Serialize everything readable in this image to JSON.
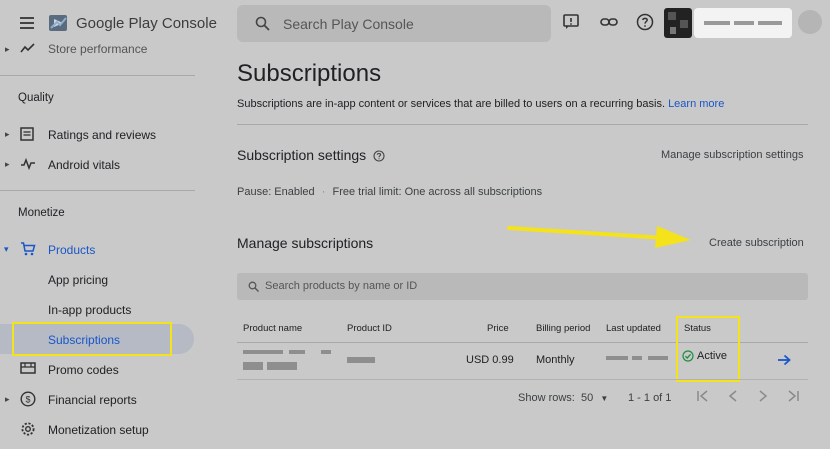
{
  "topbar": {
    "brand": "Google Play Console",
    "search_placeholder": "Search Play Console"
  },
  "sidebar": {
    "partial_item": "Store performance",
    "sections": [
      {
        "heading": "Quality"
      },
      {
        "heading": "Monetize"
      }
    ],
    "quality_items": [
      "Ratings and reviews",
      "Android vitals"
    ],
    "monetize_items": {
      "products": "Products",
      "app_pricing": "App pricing",
      "inapp": "In-app products",
      "subscriptions": "Subscriptions",
      "promo": "Promo codes",
      "financial": "Financial reports",
      "setup": "Monetization setup"
    }
  },
  "main": {
    "title": "Subscriptions",
    "subtitle": "Subscriptions are in-app content or services that are billed to users on a recurring basis.",
    "learn_more": "Learn more",
    "settings": {
      "title": "Subscription settings",
      "manage_link": "Manage subscription settings",
      "pause": "Pause: Enabled",
      "dot": "·",
      "trial": "Free trial limit: One across all subscriptions"
    },
    "manage": {
      "title": "Manage subscriptions",
      "create_link": "Create subscription",
      "filter_placeholder": "Search products by name or ID"
    },
    "table": {
      "headers": [
        "Product name",
        "Product ID",
        "Price",
        "Billing period",
        "Last updated",
        "Status"
      ],
      "rows": [
        {
          "price": "USD 0.99",
          "billing": "Monthly",
          "status": "Active"
        }
      ]
    },
    "pager": {
      "show_rows": "Show rows:",
      "rows_value": "50",
      "range": "1 - 1 of 1"
    }
  },
  "colors": {
    "accent": "#1a56c8",
    "highlight": "#f4e21a",
    "active_green": "#1e8e3e"
  }
}
